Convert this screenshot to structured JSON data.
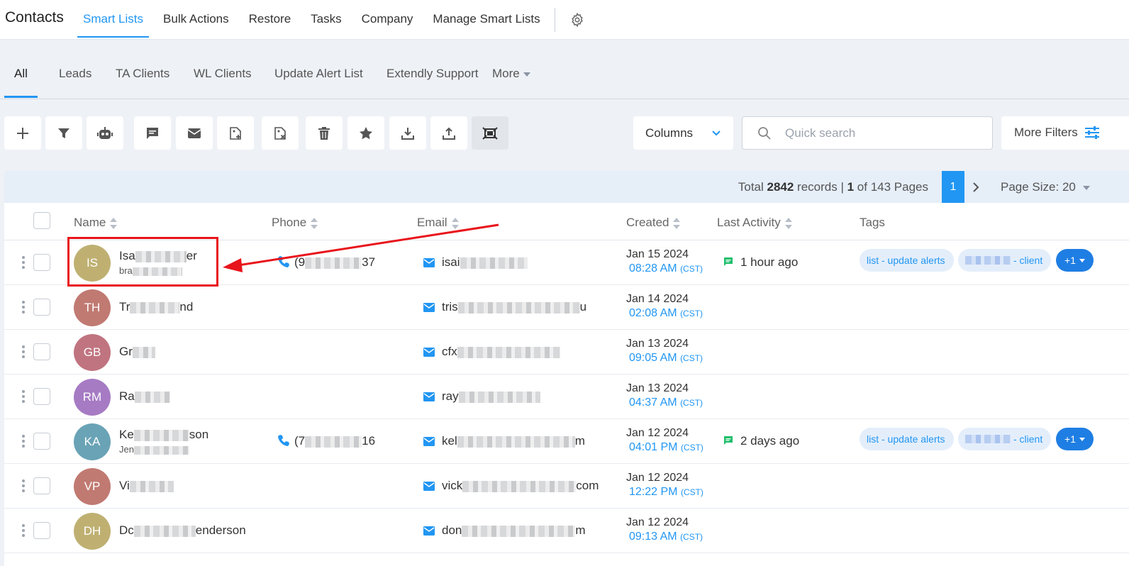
{
  "app": {
    "title": "Contacts"
  },
  "topnav": {
    "items": [
      "Smart Lists",
      "Bulk Actions",
      "Restore",
      "Tasks",
      "Company",
      "Manage Smart Lists"
    ]
  },
  "subtabs": {
    "items": [
      "All",
      "Leads",
      "TA Clients",
      "WL Clients",
      "Update Alert List",
      "Extendly Support"
    ],
    "more": "More"
  },
  "toolbar": {
    "icons": [
      "plus-icon",
      "filter-icon",
      "robot-icon",
      "message-icon",
      "mail-icon",
      "tag-add-icon",
      "tag-remove-icon",
      "trash-icon",
      "star-icon",
      "download-icon",
      "upload-icon",
      "merge-icon"
    ],
    "columns_label": "Columns",
    "search_placeholder": "Quick search",
    "more_filters_label": "More Filters"
  },
  "pagination": {
    "total_prefix": "Total ",
    "total_records": "2842",
    "records_text": " records | ",
    "current_page": "1",
    "of_text": " of 143 Pages",
    "page_size_label": "Page Size: 20"
  },
  "table": {
    "headers": {
      "name": "Name",
      "phone": "Phone",
      "email": "Email",
      "created": "Created",
      "last_activity": "Last Activity",
      "tags": "Tags"
    },
    "rows": [
      {
        "initials": "IS",
        "avatar_color": "#bfb072",
        "name_start": "Isa",
        "name_end": "er",
        "sub_start": "bra",
        "phone_start": "(9",
        "phone_end": "37",
        "email_start": "isai",
        "email_end": "",
        "date": "Jan 15 2024",
        "time": "08:28 AM",
        "tz": "(CST)",
        "activity": "1 hour ago",
        "tag1": "list - update alerts",
        "tag2": "- client",
        "tag_more": "+1"
      },
      {
        "initials": "TH",
        "avatar_color": "#c07a72",
        "name_start": "Tr",
        "name_end": "nd",
        "email_start": "tris",
        "email_end": "u",
        "date": "Jan 14 2024",
        "time": "02:08 AM",
        "tz": "(CST)"
      },
      {
        "initials": "GB",
        "avatar_color": "#c07480",
        "name_start": "Gr",
        "name_end": "",
        "email_start": "cfx",
        "email_end": "",
        "date": "Jan 13 2024",
        "time": "09:05 AM",
        "tz": "(CST)"
      },
      {
        "initials": "RM",
        "avatar_color": "#a67bc4",
        "name_start": "Ra",
        "name_end": "",
        "email_start": "ray",
        "email_end": "",
        "date": "Jan 13 2024",
        "time": "04:37 AM",
        "tz": "(CST)"
      },
      {
        "initials": "KA",
        "avatar_color": "#6aa3b6",
        "name_start": "Ke",
        "name_end": "son",
        "sub_start": "Jen",
        "phone_start": "(7",
        "phone_end": "16",
        "email_start": "kel",
        "email_end": "m",
        "date": "Jan 12 2024",
        "time": "04:01 PM",
        "tz": "(CST)",
        "activity": "2 days ago",
        "tag1": "list - update alerts",
        "tag2": "- client",
        "tag_more": "+1"
      },
      {
        "initials": "VP",
        "avatar_color": "#c07a72",
        "name_start": "Vi",
        "name_end": "",
        "email_start": "vick",
        "email_end": "com",
        "date": "Jan 12 2024",
        "time": "12:22 PM",
        "tz": "(CST)"
      },
      {
        "initials": "DH",
        "avatar_color": "#bfb072",
        "name_start": "Dc",
        "name_end": "enderson",
        "email_start": "don",
        "email_end": "m",
        "date": "Jan 12 2024",
        "time": "09:13 AM",
        "tz": "(CST)"
      }
    ]
  },
  "colors": {
    "accent": "#2196f3",
    "annotation": "#e8141b"
  }
}
